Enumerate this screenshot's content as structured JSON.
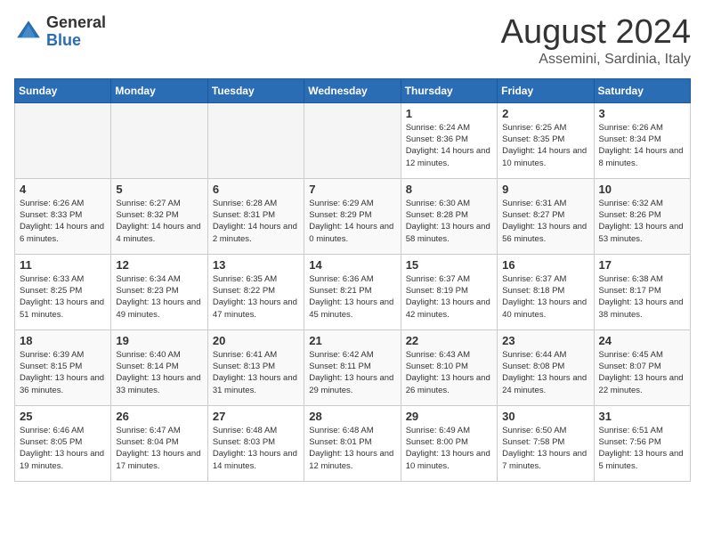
{
  "header": {
    "logo_general": "General",
    "logo_blue": "Blue",
    "month_year": "August 2024",
    "location": "Assemini, Sardinia, Italy"
  },
  "weekdays": [
    "Sunday",
    "Monday",
    "Tuesday",
    "Wednesday",
    "Thursday",
    "Friday",
    "Saturday"
  ],
  "weeks": [
    [
      {
        "day": "",
        "empty": true
      },
      {
        "day": "",
        "empty": true
      },
      {
        "day": "",
        "empty": true
      },
      {
        "day": "",
        "empty": true
      },
      {
        "day": "1",
        "sunrise": "6:24 AM",
        "sunset": "8:36 PM",
        "daylight": "14 hours and 12 minutes."
      },
      {
        "day": "2",
        "sunrise": "6:25 AM",
        "sunset": "8:35 PM",
        "daylight": "14 hours and 10 minutes."
      },
      {
        "day": "3",
        "sunrise": "6:26 AM",
        "sunset": "8:34 PM",
        "daylight": "14 hours and 8 minutes."
      }
    ],
    [
      {
        "day": "4",
        "sunrise": "6:26 AM",
        "sunset": "8:33 PM",
        "daylight": "14 hours and 6 minutes."
      },
      {
        "day": "5",
        "sunrise": "6:27 AM",
        "sunset": "8:32 PM",
        "daylight": "14 hours and 4 minutes."
      },
      {
        "day": "6",
        "sunrise": "6:28 AM",
        "sunset": "8:31 PM",
        "daylight": "14 hours and 2 minutes."
      },
      {
        "day": "7",
        "sunrise": "6:29 AM",
        "sunset": "8:29 PM",
        "daylight": "14 hours and 0 minutes."
      },
      {
        "day": "8",
        "sunrise": "6:30 AM",
        "sunset": "8:28 PM",
        "daylight": "13 hours and 58 minutes."
      },
      {
        "day": "9",
        "sunrise": "6:31 AM",
        "sunset": "8:27 PM",
        "daylight": "13 hours and 56 minutes."
      },
      {
        "day": "10",
        "sunrise": "6:32 AM",
        "sunset": "8:26 PM",
        "daylight": "13 hours and 53 minutes."
      }
    ],
    [
      {
        "day": "11",
        "sunrise": "6:33 AM",
        "sunset": "8:25 PM",
        "daylight": "13 hours and 51 minutes."
      },
      {
        "day": "12",
        "sunrise": "6:34 AM",
        "sunset": "8:23 PM",
        "daylight": "13 hours and 49 minutes."
      },
      {
        "day": "13",
        "sunrise": "6:35 AM",
        "sunset": "8:22 PM",
        "daylight": "13 hours and 47 minutes."
      },
      {
        "day": "14",
        "sunrise": "6:36 AM",
        "sunset": "8:21 PM",
        "daylight": "13 hours and 45 minutes."
      },
      {
        "day": "15",
        "sunrise": "6:37 AM",
        "sunset": "8:19 PM",
        "daylight": "13 hours and 42 minutes."
      },
      {
        "day": "16",
        "sunrise": "6:37 AM",
        "sunset": "8:18 PM",
        "daylight": "13 hours and 40 minutes."
      },
      {
        "day": "17",
        "sunrise": "6:38 AM",
        "sunset": "8:17 PM",
        "daylight": "13 hours and 38 minutes."
      }
    ],
    [
      {
        "day": "18",
        "sunrise": "6:39 AM",
        "sunset": "8:15 PM",
        "daylight": "13 hours and 36 minutes."
      },
      {
        "day": "19",
        "sunrise": "6:40 AM",
        "sunset": "8:14 PM",
        "daylight": "13 hours and 33 minutes."
      },
      {
        "day": "20",
        "sunrise": "6:41 AM",
        "sunset": "8:13 PM",
        "daylight": "13 hours and 31 minutes."
      },
      {
        "day": "21",
        "sunrise": "6:42 AM",
        "sunset": "8:11 PM",
        "daylight": "13 hours and 29 minutes."
      },
      {
        "day": "22",
        "sunrise": "6:43 AM",
        "sunset": "8:10 PM",
        "daylight": "13 hours and 26 minutes."
      },
      {
        "day": "23",
        "sunrise": "6:44 AM",
        "sunset": "8:08 PM",
        "daylight": "13 hours and 24 minutes."
      },
      {
        "day": "24",
        "sunrise": "6:45 AM",
        "sunset": "8:07 PM",
        "daylight": "13 hours and 22 minutes."
      }
    ],
    [
      {
        "day": "25",
        "sunrise": "6:46 AM",
        "sunset": "8:05 PM",
        "daylight": "13 hours and 19 minutes."
      },
      {
        "day": "26",
        "sunrise": "6:47 AM",
        "sunset": "8:04 PM",
        "daylight": "13 hours and 17 minutes."
      },
      {
        "day": "27",
        "sunrise": "6:48 AM",
        "sunset": "8:03 PM",
        "daylight": "13 hours and 14 minutes."
      },
      {
        "day": "28",
        "sunrise": "6:48 AM",
        "sunset": "8:01 PM",
        "daylight": "13 hours and 12 minutes."
      },
      {
        "day": "29",
        "sunrise": "6:49 AM",
        "sunset": "8:00 PM",
        "daylight": "13 hours and 10 minutes."
      },
      {
        "day": "30",
        "sunrise": "6:50 AM",
        "sunset": "7:58 PM",
        "daylight": "13 hours and 7 minutes."
      },
      {
        "day": "31",
        "sunrise": "6:51 AM",
        "sunset": "7:56 PM",
        "daylight": "13 hours and 5 minutes."
      }
    ]
  ]
}
